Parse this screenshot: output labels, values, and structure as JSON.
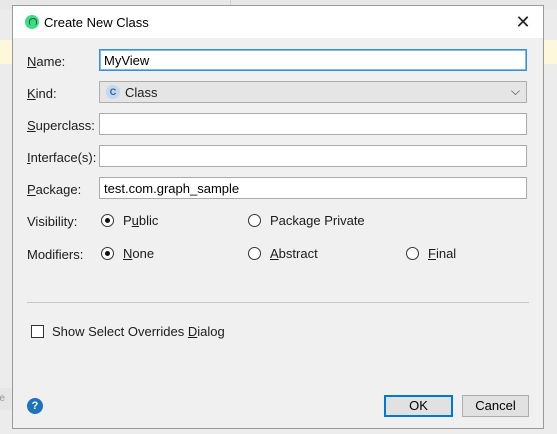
{
  "dialog": {
    "title": "Create New Class",
    "close_glyph": "✕"
  },
  "form": {
    "name": {
      "label_key": "N",
      "label_rest": "ame:",
      "value": "MyView"
    },
    "kind": {
      "label_key": "K",
      "label_rest": "ind:",
      "value": "Class",
      "icon_letter": "C"
    },
    "superclass": {
      "label_key": "S",
      "label_rest": "uperclass:",
      "value": ""
    },
    "interfaces": {
      "label_key": "I",
      "label_rest": "nterface(s):",
      "value": ""
    },
    "package": {
      "label_key": "P",
      "label_rest": "ackage:",
      "value": "test.com.graph_sample"
    }
  },
  "visibility": {
    "label": "Visibility:",
    "options": [
      {
        "key": "u",
        "pre": "P",
        "post": "blic",
        "checked": true
      },
      {
        "text": "Package Private",
        "checked": false
      }
    ]
  },
  "modifiers": {
    "label": "Modifiers:",
    "options": [
      {
        "key": "N",
        "rest": "one",
        "checked": true
      },
      {
        "key": "A",
        "rest": "bstract",
        "checked": false
      },
      {
        "key": "F",
        "rest": "inal",
        "checked": false
      }
    ]
  },
  "overrides_checkbox": {
    "pre": "Show Select Overrides ",
    "key": "D",
    "post": "ialog",
    "checked": false
  },
  "buttons": {
    "help_glyph": "?",
    "ok": "OK",
    "cancel": "Cancel"
  },
  "background": {
    "fragment_text": "he"
  },
  "colors": {
    "accent": "#0078d7",
    "focus": "#3a8fd9",
    "help": "#1e73be"
  },
  "icons": {
    "app": "android-studio-icon",
    "close": "close-icon",
    "class": "class-icon",
    "dropdown": "chevron-down-icon",
    "help": "help-icon"
  }
}
